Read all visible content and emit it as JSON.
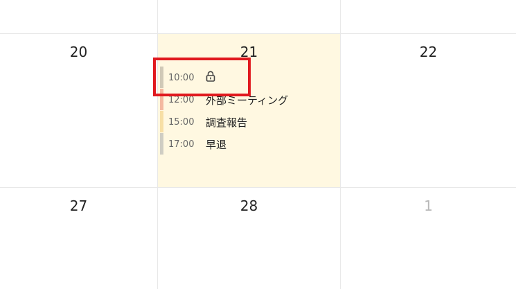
{
  "weeks": [
    {
      "days": [
        {
          "number": "20",
          "muted": false
        },
        {
          "number": "21",
          "muted": false,
          "today": true
        },
        {
          "number": "22",
          "muted": false
        }
      ]
    },
    {
      "days": [
        {
          "number": "27",
          "muted": false
        },
        {
          "number": "28",
          "muted": false
        },
        {
          "number": "1",
          "muted": true
        }
      ]
    }
  ],
  "events_day21": [
    {
      "time": "10:00",
      "title": "",
      "icon": "lock-icon",
      "color": "#d0c9b7"
    },
    {
      "time": "12:00",
      "title": "外部ミーティング",
      "color": "#f4b9a0"
    },
    {
      "time": "15:00",
      "title": "調査報告",
      "color": "#f7dfa5"
    },
    {
      "time": "17:00",
      "title": "早退",
      "color": "#cfcdc3"
    }
  ],
  "colors": {
    "today_background": "#fff8e1",
    "grid_line": "#e8e8e8",
    "highlight_border": "#e0191e"
  }
}
